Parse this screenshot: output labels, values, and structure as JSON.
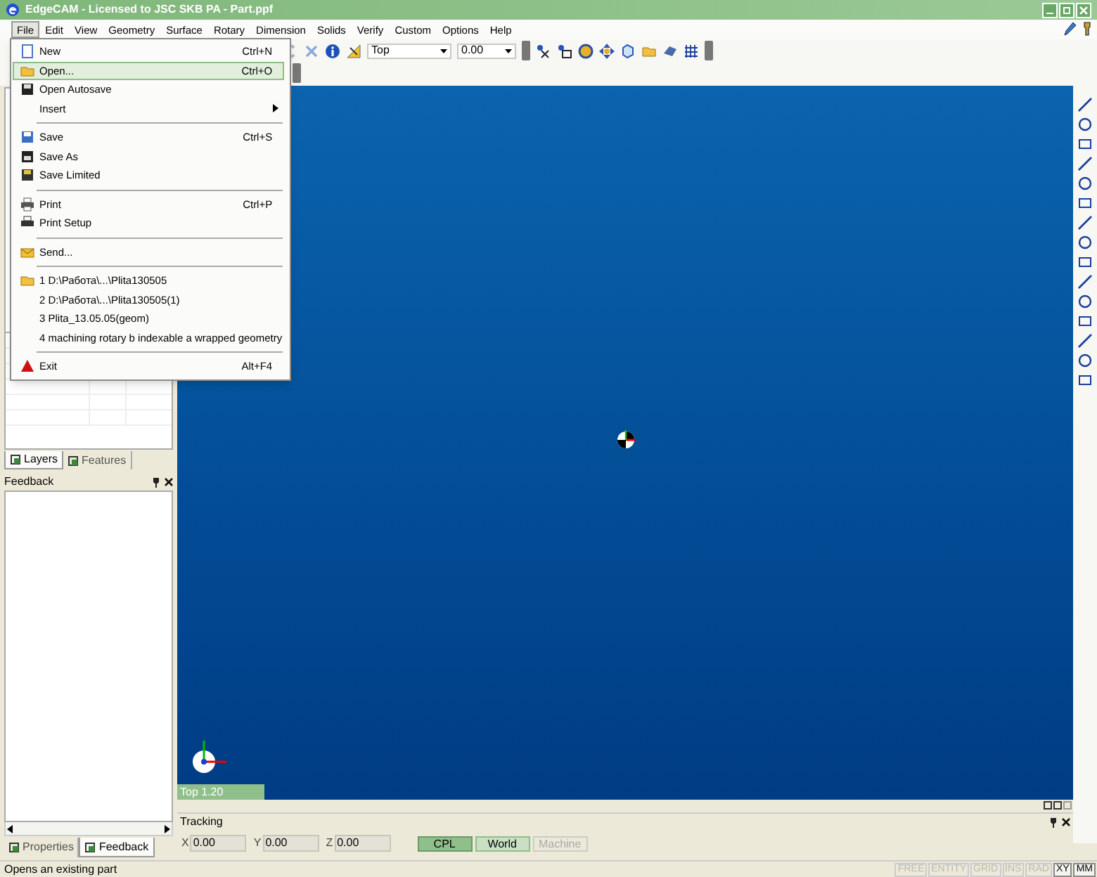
{
  "window": {
    "title": "EdgeCAM - Licensed to JSC SKB PA - Part.ppf"
  },
  "menu_bar": [
    {
      "label": "File",
      "selected": true
    },
    {
      "label": "Edit",
      "selected": false
    },
    {
      "label": "View",
      "selected": false
    },
    {
      "label": "Geometry",
      "selected": false
    },
    {
      "label": "Surface",
      "selected": false
    },
    {
      "label": "Rotary",
      "selected": false
    },
    {
      "label": "Dimension",
      "selected": false
    },
    {
      "label": "Solids",
      "selected": false
    },
    {
      "label": "Verify",
      "selected": false
    },
    {
      "label": "Custom",
      "selected": false
    },
    {
      "label": "Options",
      "selected": false
    },
    {
      "label": "Help",
      "selected": false
    }
  ],
  "file_menu": [
    {
      "kind": "item",
      "label": "New",
      "shortcut": "Ctrl+N",
      "selected": false
    },
    {
      "kind": "item",
      "label": "Open...",
      "shortcut": "Ctrl+O",
      "selected": true
    },
    {
      "kind": "item",
      "label": "Open Autosave",
      "selected": false
    },
    {
      "kind": "submenu",
      "label": "Insert",
      "selected": false
    },
    {
      "kind": "separator"
    },
    {
      "kind": "item",
      "label": "Save",
      "shortcut": "Ctrl+S",
      "selected": false
    },
    {
      "kind": "item",
      "label": "Save As",
      "selected": false
    },
    {
      "kind": "item",
      "label": "Save Limited",
      "selected": false
    },
    {
      "kind": "separator"
    },
    {
      "kind": "item",
      "label": "Print",
      "shortcut": "Ctrl+P",
      "selected": false
    },
    {
      "kind": "item",
      "label": "Print Setup",
      "selected": false
    },
    {
      "kind": "separator"
    },
    {
      "kind": "item",
      "label": "Send...",
      "selected": false
    },
    {
      "kind": "separator"
    },
    {
      "kind": "item",
      "label": "1 D:\\Работа\\...\\Plita130505",
      "selected": false
    },
    {
      "kind": "item",
      "label": "2 D:\\Работа\\...\\Plita130505(1)",
      "selected": false
    },
    {
      "kind": "item",
      "label": "3 Plita_13.05.05(geom)",
      "selected": false
    },
    {
      "kind": "item",
      "label": "4 machining rotary b indexable a wrapped geometry",
      "selected": false
    },
    {
      "kind": "separator"
    },
    {
      "kind": "item",
      "label": "Exit",
      "shortcut": "Alt+F4",
      "selected": false
    }
  ],
  "toolbar": {
    "view_select": "Top",
    "value_select": "0.00"
  },
  "left_panel": {
    "tabs": [
      {
        "label": "Layers",
        "selected": true
      },
      {
        "label": "Features",
        "selected": false
      }
    ],
    "feedback_title": "Feedback",
    "bottom_tabs": [
      {
        "label": "Properties",
        "selected": false
      },
      {
        "label": "Feedback",
        "selected": true
      }
    ]
  },
  "viewport": {
    "view_label": "Top 1.20"
  },
  "tracking": {
    "title": "Tracking",
    "coords": [
      {
        "axis": "X",
        "value": "0.00"
      },
      {
        "axis": "Y",
        "value": "0.00"
      },
      {
        "axis": "Z",
        "value": "0.00"
      }
    ],
    "modes": [
      {
        "label": "CPL",
        "selected": true,
        "disabled": false
      },
      {
        "label": "World",
        "selected": false,
        "disabled": false
      },
      {
        "label": "Machine",
        "selected": false,
        "disabled": true
      }
    ]
  },
  "status_bar": {
    "message": "Opens an existing part",
    "indicators": [
      {
        "label": "FREE",
        "on": false
      },
      {
        "label": "ENTITY",
        "on": false
      },
      {
        "label": "GRID",
        "on": false
      },
      {
        "label": "INS",
        "on": false
      },
      {
        "label": "RAD",
        "on": false
      },
      {
        "label": "XY",
        "on": true
      },
      {
        "label": "MM",
        "on": true
      }
    ]
  }
}
